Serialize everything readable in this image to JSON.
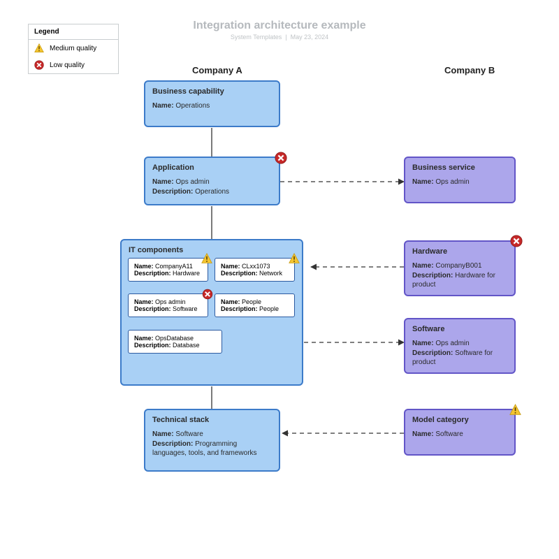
{
  "header": {
    "title": "Integration architecture example",
    "subtitle_left": "System Templates",
    "subtitle_divider": "|",
    "subtitle_right": "May 23, 2024"
  },
  "legend": {
    "heading": "Legend",
    "medium": "Medium quality",
    "low": "Low quality"
  },
  "columns": {
    "a": "Company A",
    "b": "Company B"
  },
  "labels": {
    "name": "Name:",
    "desc": "Description:"
  },
  "a": {
    "bizcap": {
      "title": "Business capability",
      "name": "Operations"
    },
    "app": {
      "title": "Application",
      "name": "Ops admin",
      "desc": "Operations",
      "badge": "low"
    },
    "itcomp": {
      "title": "IT components",
      "items": [
        {
          "name": "CompanyA11",
          "desc": "Hardware",
          "badge": "medium"
        },
        {
          "name": "CLxx1073",
          "desc": "Network",
          "badge": "medium"
        },
        {
          "name": "Ops admin",
          "desc": "Software",
          "badge": "low"
        },
        {
          "name": "People",
          "desc": "People"
        },
        {
          "name": "OpsDatabase",
          "desc": "Database"
        }
      ]
    },
    "tech": {
      "title": "Technical stack",
      "name": "Software",
      "desc": "Programming languages, tools, and frameworks"
    }
  },
  "b": {
    "svc": {
      "title": "Business service",
      "name": "Ops admin"
    },
    "hw": {
      "title": "Hardware",
      "name": "CompanyB001",
      "desc": "Hardware for product",
      "badge": "low"
    },
    "sw": {
      "title": "Software",
      "name": "Ops admin",
      "desc": "Software for product"
    },
    "mc": {
      "title": "Model category",
      "name": "Software",
      "badge": "medium"
    }
  }
}
